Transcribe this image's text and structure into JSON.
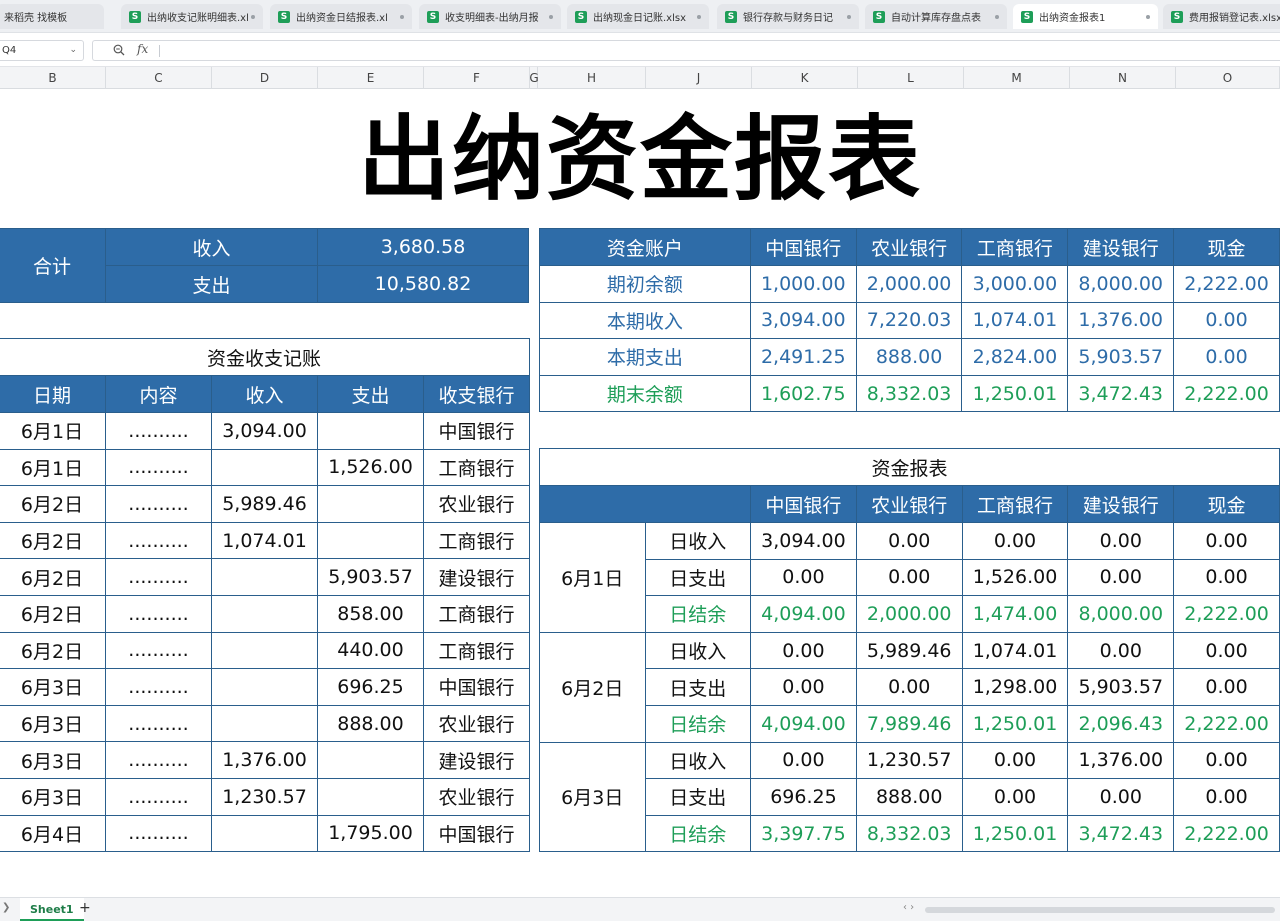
{
  "tabs": [
    {
      "label": "来稻壳 找模板",
      "icon": false
    },
    {
      "label": "出纳收支记账明细表.xl",
      "icon": true
    },
    {
      "label": "出纳资金日结报表.xl",
      "icon": true
    },
    {
      "label": "收支明细表-出纳月报",
      "icon": true
    },
    {
      "label": "出纳现金日记账.xlsx",
      "icon": true
    },
    {
      "label": "银行存款与财务日记",
      "icon": true
    },
    {
      "label": "自动计算库存盘点表",
      "icon": true
    },
    {
      "label": "出纳资金报表1",
      "icon": true,
      "active": true
    },
    {
      "label": "费用报销登记表.xlsx",
      "icon": true
    }
  ],
  "formula_bar": {
    "name_box": "Q4",
    "fx_label": "fx",
    "content": ""
  },
  "columns": [
    "B",
    "C",
    "D",
    "E",
    "F",
    "G",
    "H",
    "J",
    "K",
    "L",
    "M",
    "N",
    "O"
  ],
  "sheet_title": "出纳资金报表",
  "summary": {
    "label": "合计",
    "rows": [
      {
        "label": "收入",
        "value": "3,680.58"
      },
      {
        "label": "支出",
        "value": "10,580.82"
      }
    ]
  },
  "records": {
    "caption": "资金收支记账",
    "headers": [
      "日期",
      "内容",
      "收入",
      "支出",
      "收支银行"
    ],
    "rows": [
      [
        "6月1日",
        "..........",
        "3,094.00",
        "",
        "中国银行"
      ],
      [
        "6月1日",
        "..........",
        "",
        "1,526.00",
        "工商银行"
      ],
      [
        "6月2日",
        "..........",
        "5,989.46",
        "",
        "农业银行"
      ],
      [
        "6月2日",
        "..........",
        "1,074.01",
        "",
        "工商银行"
      ],
      [
        "6月2日",
        "..........",
        "",
        "5,903.57",
        "建设银行"
      ],
      [
        "6月2日",
        "..........",
        "",
        "858.00",
        "工商银行"
      ],
      [
        "6月2日",
        "..........",
        "",
        "440.00",
        "工商银行"
      ],
      [
        "6月3日",
        "..........",
        "",
        "696.25",
        "中国银行"
      ],
      [
        "6月3日",
        "..........",
        "",
        "888.00",
        "农业银行"
      ],
      [
        "6月3日",
        "..........",
        "1,376.00",
        "",
        "建设银行"
      ],
      [
        "6月3日",
        "..........",
        "1,230.57",
        "",
        "农业银行"
      ],
      [
        "6月4日",
        "..........",
        "",
        "1,795.00",
        "中国银行"
      ]
    ]
  },
  "accounts": {
    "headers": [
      "资金账户",
      "中国银行",
      "农业银行",
      "工商银行",
      "建设银行",
      "现金"
    ],
    "rows": [
      {
        "label": "期初余额",
        "values": [
          "1,000.00",
          "2,000.00",
          "3,000.00",
          "8,000.00",
          "2,222.00"
        ],
        "style": "blue"
      },
      {
        "label": "本期收入",
        "values": [
          "3,094.00",
          "7,220.03",
          "1,074.01",
          "1,376.00",
          "0.00"
        ],
        "style": "blue"
      },
      {
        "label": "本期支出",
        "values": [
          "2,491.25",
          "888.00",
          "2,824.00",
          "5,903.57",
          "0.00"
        ],
        "style": "blue"
      },
      {
        "label": "期末余额",
        "values": [
          "1,602.75",
          "8,332.03",
          "1,250.01",
          "3,472.43",
          "2,222.00"
        ],
        "style": "green"
      }
    ]
  },
  "report": {
    "caption": "资金报表",
    "headers": [
      "",
      "中国银行",
      "农业银行",
      "工商银行",
      "建设银行",
      "现金"
    ],
    "groups": [
      {
        "date": "6月1日",
        "rows": [
          {
            "label": "日收入",
            "values": [
              "3,094.00",
              "0.00",
              "0.00",
              "0.00",
              "0.00"
            ],
            "style": "normal"
          },
          {
            "label": "日支出",
            "values": [
              "0.00",
              "0.00",
              "1,526.00",
              "0.00",
              "0.00"
            ],
            "style": "normal"
          },
          {
            "label": "日结余",
            "values": [
              "4,094.00",
              "2,000.00",
              "1,474.00",
              "8,000.00",
              "2,222.00"
            ],
            "style": "green"
          }
        ]
      },
      {
        "date": "6月2日",
        "rows": [
          {
            "label": "日收入",
            "values": [
              "0.00",
              "5,989.46",
              "1,074.01",
              "0.00",
              "0.00"
            ],
            "style": "normal"
          },
          {
            "label": "日支出",
            "values": [
              "0.00",
              "0.00",
              "1,298.00",
              "5,903.57",
              "0.00"
            ],
            "style": "normal"
          },
          {
            "label": "日结余",
            "values": [
              "4,094.00",
              "7,989.46",
              "1,250.01",
              "2,096.43",
              "2,222.00"
            ],
            "style": "green"
          }
        ]
      },
      {
        "date": "6月3日",
        "rows": [
          {
            "label": "日收入",
            "values": [
              "0.00",
              "1,230.57",
              "0.00",
              "1,376.00",
              "0.00"
            ],
            "style": "normal"
          },
          {
            "label": "日支出",
            "values": [
              "696.25",
              "888.00",
              "0.00",
              "0.00",
              "0.00"
            ],
            "style": "normal"
          },
          {
            "label": "日结余",
            "values": [
              "3,397.75",
              "8,332.03",
              "1,250.01",
              "3,472.43",
              "2,222.00"
            ],
            "style": "green"
          }
        ]
      }
    ]
  },
  "sheet_tabs": [
    {
      "label": "Sheet1",
      "active": true
    }
  ],
  "add_sheet_label": "+",
  "colors": {
    "header_blue": "#2e6ca8",
    "text_blue": "#2e6ca8",
    "green": "#1e9e58",
    "border": "#2a5e8c"
  }
}
